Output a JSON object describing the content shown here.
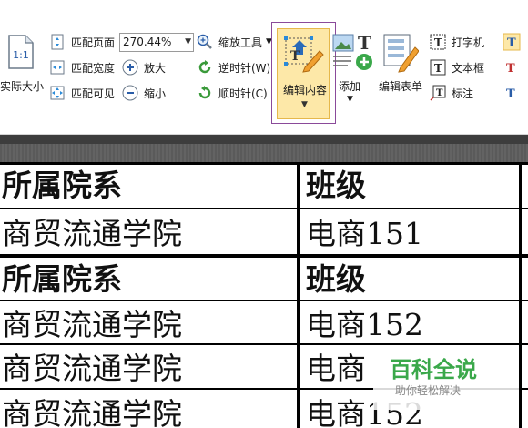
{
  "toolbar": {
    "actual_size": "实际大小",
    "fit_page": "匹配页面",
    "fit_width": "匹配宽度",
    "fit_visible": "匹配可见",
    "zoom_value": "270.44%",
    "zoom_in": "放大",
    "zoom_out": "缩小",
    "zoom_tool": "缩放工具",
    "rotate_ccw": "逆时针(W)",
    "rotate_cw": "顺时针(C)",
    "edit_content": "编辑内容",
    "add": "添加",
    "edit_form": "编辑表单",
    "typewriter": "打字机",
    "textbox": "文本框",
    "callout": "标注",
    "accent_color": "#f0b429",
    "selection_color": "#8a4a9a"
  },
  "table": {
    "rows": [
      {
        "dept": "所属院系",
        "class": "班级",
        "bold": true
      },
      {
        "dept": "商贸流通学院",
        "class": "电商151",
        "bold": false
      },
      {
        "dept": "所属院系",
        "class": "班级",
        "bold": true
      },
      {
        "dept": "商贸流通学院",
        "class": "电商152",
        "bold": false
      },
      {
        "dept": "商贸流通学院",
        "class": "电商",
        "bold": false
      },
      {
        "dept": "商贸流通学院",
        "class": "电商152",
        "bold": false
      }
    ]
  },
  "watermark": {
    "title": "百科全说",
    "subtitle": "助你轻松解决",
    "color": "#3aa84a"
  }
}
